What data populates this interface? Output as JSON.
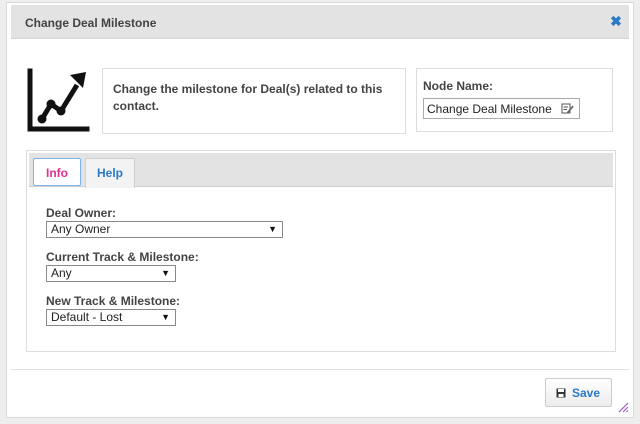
{
  "dialog": {
    "title": "Change Deal Milestone",
    "close_icon": "close-icon",
    "description": "Change the milestone for Deal(s) related to this contact.",
    "node": {
      "label": "Node Name:",
      "value": "Change Deal Milestone",
      "edit_icon": "edit-icon"
    },
    "tabs": [
      {
        "label": "Info",
        "active": true
      },
      {
        "label": "Help",
        "active": false
      }
    ],
    "fields": [
      {
        "label": "Deal Owner:",
        "value": "Any Owner"
      },
      {
        "label": "Current Track & Milestone:",
        "value": "Any"
      },
      {
        "label": "New Track & Milestone:",
        "value": "Default - Lost"
      }
    ],
    "save_label": "Save"
  },
  "colors": {
    "accent_blue": "#2a7ac7",
    "active_tab_text": "#e0308f",
    "titlebar_bg": "#e3e3e3"
  }
}
